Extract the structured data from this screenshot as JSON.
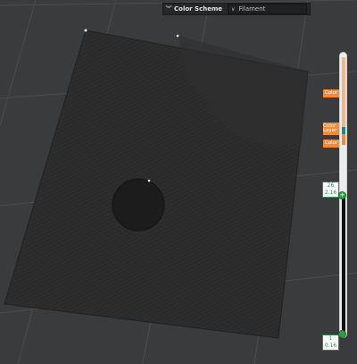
{
  "toolbar": {
    "collapse_icon": "double-chevron-down-icon",
    "label": "Color Scheme",
    "select_value": "Filament"
  },
  "slider": {
    "markers": [
      "Color",
      "Color Layer",
      "Color"
    ],
    "upper": {
      "layer": "26",
      "height": "2.16"
    },
    "lower": {
      "layer": "1",
      "height": "0.16"
    }
  },
  "colors": {
    "accent": "#f28a3c",
    "handle": "#2ea043",
    "plate": "#2d2d2d",
    "grid": "#4b4c4e"
  }
}
